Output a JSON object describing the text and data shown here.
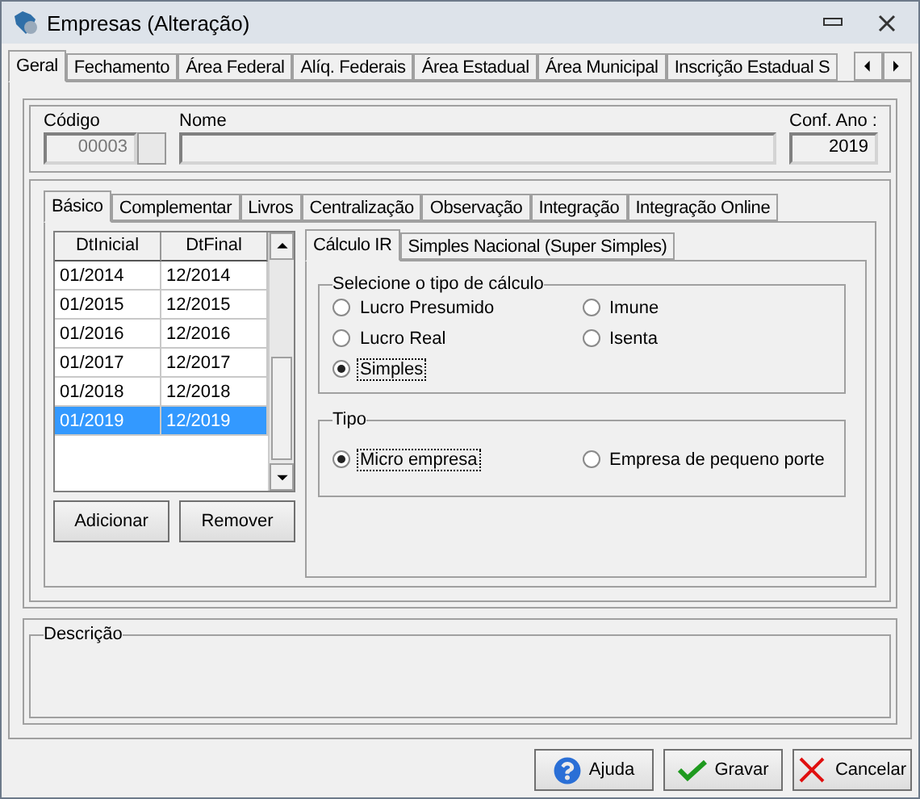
{
  "window": {
    "title": "Empresas (Alteração)"
  },
  "tabs": [
    {
      "label": "Geral",
      "selected": true
    },
    {
      "label": "Fechamento",
      "selected": false
    },
    {
      "label": "Área Federal",
      "selected": false
    },
    {
      "label": "Alíq. Federais",
      "selected": false
    },
    {
      "label": "Área Estadual",
      "selected": false
    },
    {
      "label": "Área Municipal",
      "selected": false
    },
    {
      "label": "Inscrição Estadual S",
      "selected": false
    }
  ],
  "header": {
    "code": {
      "label": "Código",
      "value": "00003"
    },
    "name": {
      "label": "Nome"
    },
    "year": {
      "label": "Conf. Ano :",
      "value": "2019"
    }
  },
  "sub_tabs": [
    {
      "label": "Básico",
      "selected": true
    },
    {
      "label": "Complementar",
      "selected": false
    },
    {
      "label": "Livros",
      "selected": false
    },
    {
      "label": "Centralização",
      "selected": false
    },
    {
      "label": "Observação",
      "selected": false
    },
    {
      "label": "Integração",
      "selected": false
    },
    {
      "label": "Integração Online",
      "selected": false
    }
  ],
  "periods": {
    "columns": [
      "DtInicial",
      "DtFinal"
    ],
    "rows": [
      {
        "start": "01/2014",
        "end": "12/2014",
        "selected": false
      },
      {
        "start": "01/2015",
        "end": "12/2015",
        "selected": false
      },
      {
        "start": "01/2016",
        "end": "12/2016",
        "selected": false
      },
      {
        "start": "01/2017",
        "end": "12/2017",
        "selected": false
      },
      {
        "start": "01/2018",
        "end": "12/2018",
        "selected": false
      },
      {
        "start": "01/2019",
        "end": "12/2019",
        "selected": true
      }
    ]
  },
  "period_buttons": [
    "Adicionar",
    "Remover"
  ],
  "calc_tabs": [
    {
      "label": "Cálculo IR",
      "selected": true
    },
    {
      "label": "Simples Nacional (Super Simples)",
      "selected": false
    }
  ],
  "calc_type": {
    "title": "Selecione o tipo de cálculo",
    "options": [
      {
        "label": "Lucro Presumido",
        "selected": false
      },
      {
        "label": "Imune",
        "selected": false
      },
      {
        "label": "Lucro Real",
        "selected": false
      },
      {
        "label": "Isenta",
        "selected": false
      },
      {
        "label": "Simples",
        "selected": true
      }
    ]
  },
  "company_type": {
    "title": "Tipo",
    "options": [
      {
        "label": "Micro empresa",
        "selected": true
      },
      {
        "label": "Empresa de pequeno porte",
        "selected": false
      }
    ]
  },
  "description": {
    "title": "Descrição"
  },
  "footer_buttons": [
    {
      "kind": "help",
      "label": "Ajuda"
    },
    {
      "kind": "save",
      "label": "Gravar"
    },
    {
      "kind": "cancel",
      "label": "Cancelar"
    }
  ]
}
